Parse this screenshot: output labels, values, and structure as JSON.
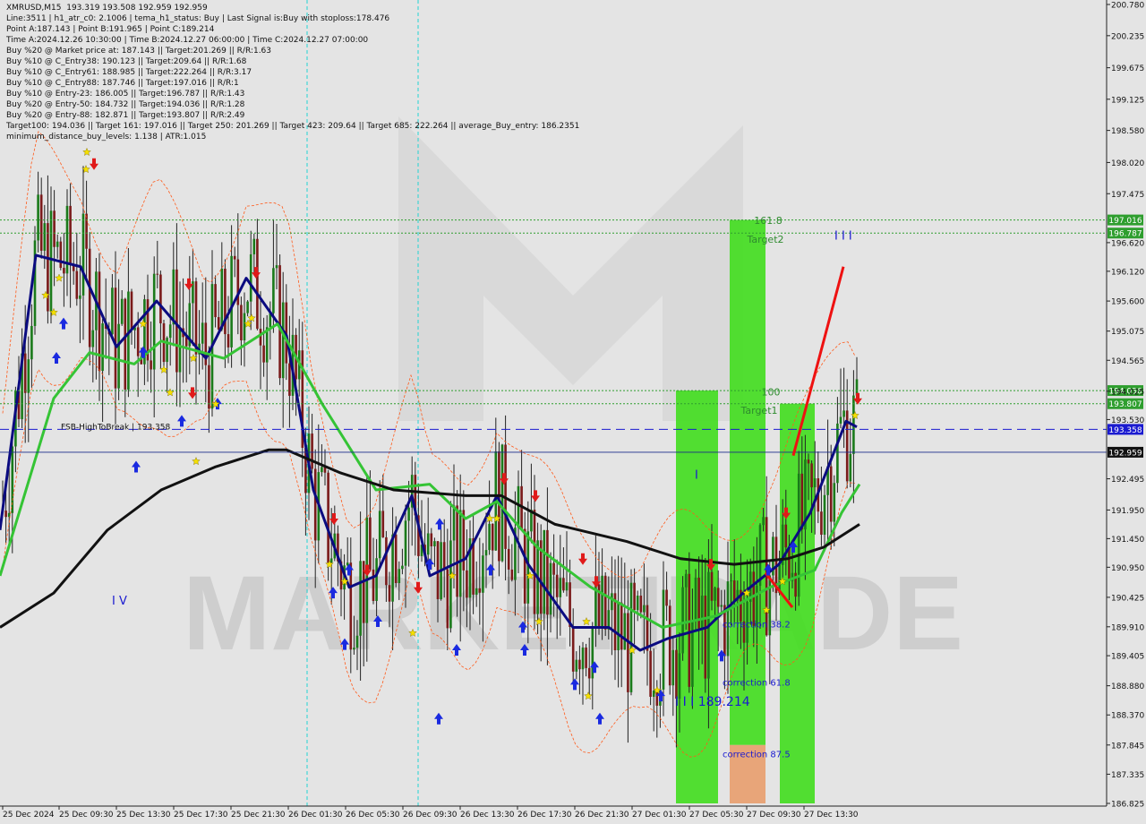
{
  "info_lines": [
    "XMRUSD,M15  193.319 193.508 192.959 192.959",
    "Line:3511 | h1_atr_c0: 2.1006 | tema_h1_status: Buy | Last Signal is:Buy with stoploss:178.476",
    "Point A:187.143 | Point B:191.965 | Point C:189.214",
    "Time A:2024.12.26 10:30:00 | Time B:2024.12.27 06:00:00 | Time C:2024.12.27 07:00:00",
    "Buy %20 @ Market price at: 187.143 || Target:201.269 || R/R:1.63",
    "Buy %10 @ C_Entry38: 190.123 || Target:209.64 || R/R:1.68",
    "Buy %10 @ C_Entry61: 188.985 || Target:222.264 || R/R:3.17",
    "Buy %10 @ C_Entry88: 187.746 || Target:197.016 || R/R:1",
    "Buy %10 @ Entry-23: 186.005 || Target:196.787 || R/R:1.43",
    "Buy %20 @ Entry-50: 184.732 || Target:194.036 || R/R:1.28",
    "Buy %20 @ Entry-88: 182.871 || Target:193.807 || R/R:2.49",
    "Target100: 194.036 || Target 161: 197.016 || Target 250: 201.269 || Target 423: 209.64 || Target 685: 222.264 || average_Buy_entry: 186.2351",
    "minimum_distance_buy_levels: 1.138 | ATR:1.015"
  ],
  "watermark": "MARKETIRADE",
  "chart_data": {
    "type": "line",
    "title": "XMRUSD,M15",
    "ohlc_last": {
      "open": 193.319,
      "high": 193.508,
      "low": 192.959,
      "close": 192.959
    },
    "ylim": [
      186.825,
      200.78
    ],
    "y_ticks": [
      200.78,
      200.235,
      199.675,
      199.125,
      198.58,
      198.02,
      197.475,
      196.62,
      196.12,
      195.6,
      195.075,
      194.565,
      194.025,
      193.53,
      192.959,
      192.495,
      191.95,
      191.45,
      190.95,
      190.425,
      189.91,
      189.405,
      188.88,
      188.37,
      187.845,
      187.335,
      186.825
    ],
    "x_ticks": [
      "25 Dec 2024",
      "25 Dec 09:30",
      "25 Dec 13:30",
      "25 Dec 17:30",
      "25 Dec 21:30",
      "26 Dec 01:30",
      "26 Dec 05:30",
      "26 Dec 09:30",
      "26 Dec 13:30",
      "26 Dec 17:30",
      "26 Dec 21:30",
      "27 Dec 01:30",
      "27 Dec 05:30",
      "27 Dec 09:30",
      "27 Dec 13:30"
    ],
    "price_line": 192.959,
    "levels": [
      {
        "value": 197.016,
        "label": "197.016",
        "color": "#2e9e2e",
        "style": "dotted"
      },
      {
        "value": 196.787,
        "label": "196.787",
        "color": "#2e9e2e",
        "style": "dotted"
      },
      {
        "value": 194.036,
        "label": "194.036",
        "color": "#2e9e2e",
        "style": "dotted"
      },
      {
        "value": 193.807,
        "label": "193.807",
        "color": "#2e9e2e",
        "style": "dotted"
      },
      {
        "value": 193.358,
        "label": "193.358",
        "color": "#1a1ad0",
        "style": "dashed"
      }
    ],
    "annotations": [
      {
        "text": "FSB-HighToBreak | 193.358",
        "color": "#111111"
      },
      {
        "text": "161.8",
        "color": "#2e8b2e"
      },
      {
        "text": "Target2",
        "color": "#2e8b2e"
      },
      {
        "text": "100",
        "color": "#2e8b2e"
      },
      {
        "text": "Target1",
        "color": "#2e8b2e"
      },
      {
        "text": "correction 38.2",
        "color": "#1a1ad0"
      },
      {
        "text": "correction 61.8",
        "color": "#1a1ad0"
      },
      {
        "text": "correction 87.5",
        "color": "#1a1ad0"
      },
      {
        "text": "I I I 189.214",
        "color": "#1a1ad0"
      },
      {
        "text": "I V",
        "color": "#1a1ad0"
      },
      {
        "text": "I",
        "color": "#1a1ad0"
      },
      {
        "text": "I I I",
        "color": "#1a1ad0"
      }
    ],
    "series": [
      {
        "name": "",
        "color": "#0b0b80",
        "points": [
          [
            0,
            191.6
          ],
          [
            40,
            196.4
          ],
          [
            90,
            196.2
          ],
          [
            130,
            194.8
          ],
          [
            175,
            195.6
          ],
          [
            230,
            194.6
          ],
          [
            275,
            196.0
          ],
          [
            320,
            195.0
          ],
          [
            350,
            192.3
          ],
          [
            390,
            190.6
          ],
          [
            420,
            190.8
          ],
          [
            460,
            192.2
          ],
          [
            480,
            190.8
          ],
          [
            520,
            191.1
          ],
          [
            555,
            192.2
          ],
          [
            590,
            191.0
          ],
          [
            640,
            189.9
          ],
          [
            680,
            189.9
          ],
          [
            715,
            189.5
          ],
          [
            745,
            189.7
          ],
          [
            790,
            189.9
          ],
          [
            830,
            190.5
          ],
          [
            870,
            191.0
          ],
          [
            905,
            191.9
          ],
          [
            945,
            193.5
          ],
          [
            957,
            193.4
          ]
        ]
      },
      {
        "name": "",
        "color": "#35c435",
        "points": [
          [
            0,
            190.8
          ],
          [
            60,
            193.9
          ],
          [
            100,
            194.7
          ],
          [
            150,
            194.5
          ],
          [
            180,
            194.9
          ],
          [
            250,
            194.6
          ],
          [
            310,
            195.2
          ],
          [
            360,
            193.8
          ],
          [
            420,
            192.3
          ],
          [
            480,
            192.4
          ],
          [
            520,
            191.8
          ],
          [
            555,
            192.1
          ],
          [
            600,
            191.3
          ],
          [
            660,
            190.6
          ],
          [
            740,
            189.9
          ],
          [
            800,
            190.1
          ],
          [
            860,
            190.6
          ],
          [
            910,
            190.9
          ],
          [
            940,
            191.9
          ],
          [
            960,
            192.4
          ]
        ]
      },
      {
        "name": "",
        "color": "#111111",
        "points": [
          [
            0,
            189.9
          ],
          [
            60,
            190.5
          ],
          [
            120,
            191.6
          ],
          [
            180,
            192.3
          ],
          [
            240,
            192.7
          ],
          [
            300,
            193.0
          ],
          [
            320,
            193.0
          ],
          [
            380,
            192.6
          ],
          [
            440,
            192.3
          ],
          [
            520,
            192.2
          ],
          [
            560,
            192.2
          ],
          [
            620,
            191.7
          ],
          [
            700,
            191.4
          ],
          [
            760,
            191.1
          ],
          [
            820,
            191.0
          ],
          [
            880,
            191.1
          ],
          [
            920,
            191.3
          ],
          [
            960,
            191.7
          ]
        ]
      }
    ]
  }
}
